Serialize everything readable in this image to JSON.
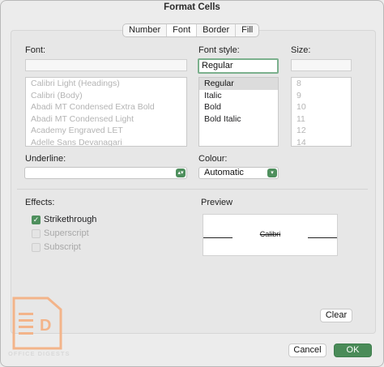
{
  "window": {
    "title": "Format Cells"
  },
  "tabs": [
    {
      "label": "Number",
      "selected": false
    },
    {
      "label": "Font",
      "selected": true
    },
    {
      "label": "Border",
      "selected": false
    },
    {
      "label": "Fill",
      "selected": false
    }
  ],
  "font": {
    "label": "Font:",
    "value": "",
    "items": [
      "Calibri Light (Headings)",
      "Calibri (Body)",
      "Abadi MT Condensed Extra Bold",
      "Abadi MT Condensed Light",
      "Academy Engraved LET",
      "Adelle Sans Devanagari"
    ]
  },
  "font_style": {
    "label": "Font style:",
    "value": "Regular",
    "items": [
      "Regular",
      "Italic",
      "Bold",
      "Bold Italic"
    ],
    "selected_index": 0
  },
  "size": {
    "label": "Size:",
    "value": "",
    "items": [
      "8",
      "9",
      "10",
      "11",
      "12",
      "14"
    ]
  },
  "underline": {
    "label": "Underline:",
    "value": ""
  },
  "colour": {
    "label": "Colour:",
    "value": "Automatic"
  },
  "effects": {
    "label": "Effects:",
    "items": [
      {
        "label": "Strikethrough",
        "checked": true,
        "enabled": true
      },
      {
        "label": "Superscript",
        "checked": false,
        "enabled": false
      },
      {
        "label": "Subscript",
        "checked": false,
        "enabled": false
      }
    ]
  },
  "preview": {
    "label": "Preview",
    "sample": "Calibri"
  },
  "buttons": {
    "clear": "Clear",
    "cancel": "Cancel",
    "ok": "OK"
  },
  "watermark": {
    "letter": "D",
    "text": "OFFICE DIGESTS"
  },
  "colors": {
    "accent": "#4e8f5d",
    "ok_button": "#4a8b58",
    "focus_ring": "#7bb08d",
    "select_arrow": "#4e8f5d",
    "watermark": "#f3b48a"
  }
}
